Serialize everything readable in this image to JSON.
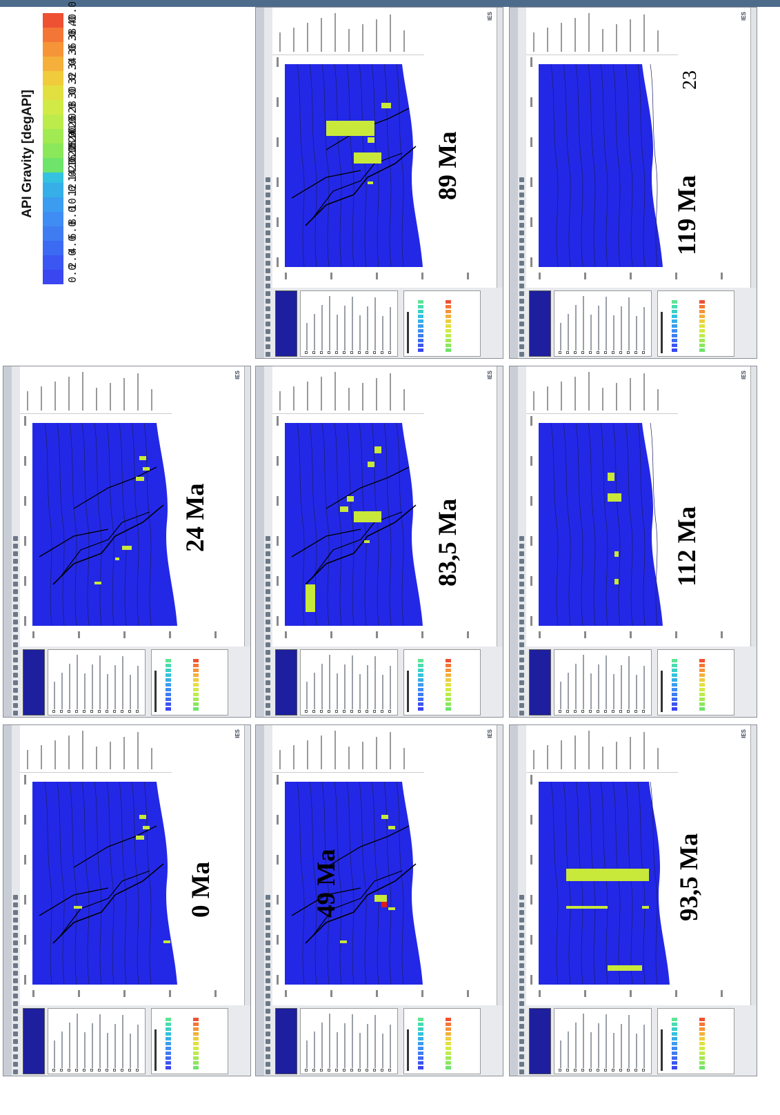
{
  "legend": {
    "title": "API Gravity [degAPI]",
    "low_scale": {
      "labels": [
        "0.0",
        "2.0",
        "4.0",
        "6.0",
        "8.0",
        "10.0",
        "12.0",
        "14.0",
        "16.0",
        "18.0",
        "20.0"
      ],
      "colors": [
        "#3a46f0",
        "#3b56f2",
        "#3c6af2",
        "#3f7cf2",
        "#3f8cf4",
        "#3c9cf0",
        "#36aee8",
        "#34c2e0",
        "#3ad0c4",
        "#48dcb0",
        "#5ee494"
      ]
    },
    "high_scale": {
      "labels": [
        "20.0",
        "22.0",
        "24.0",
        "26.0",
        "28.0",
        "30.0",
        "32.0",
        "34.0",
        "36.0",
        "38.0",
        "40.0"
      ],
      "colors": [
        "#6ee46a",
        "#8ae85a",
        "#a2ea52",
        "#bcec4c",
        "#d2ea46",
        "#e2e040",
        "#f0cc3c",
        "#f4b03a",
        "#f69438",
        "#f47636",
        "#ee5032"
      ]
    }
  },
  "panels": [
    {
      "id": "p0",
      "age": "0 Ma"
    },
    {
      "id": "p24",
      "age": "24 Ma"
    },
    {
      "id": "p49",
      "age": "49 Ma"
    },
    {
      "id": "p835",
      "age": "83,5 Ma"
    },
    {
      "id": "p89",
      "age": "89 Ma"
    },
    {
      "id": "p935",
      "age": "93,5 Ma"
    },
    {
      "id": "p112",
      "age": "112 Ma"
    },
    {
      "id": "p119",
      "age": "119 Ma"
    }
  ],
  "page_number": "23",
  "ies_logo": "IES",
  "colors": {
    "basin": "#2328e6",
    "hydrocarbon": "#c8e83a",
    "hydrocarbon_hot": "#e01a1a",
    "window": "#d6d9de"
  }
}
